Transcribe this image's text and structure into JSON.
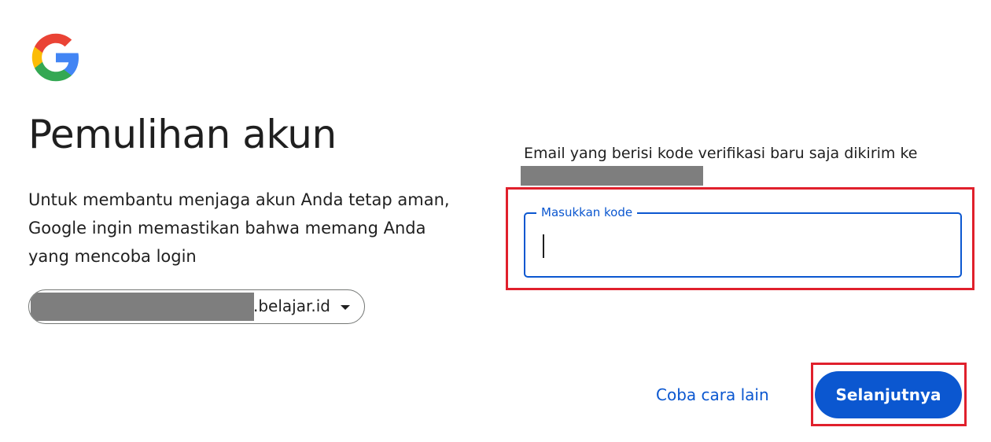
{
  "page": {
    "title": "Pemulihan akun",
    "subtitle": "Untuk membantu menjaga akun Anda tetap aman, Google ingin memastikan bahwa memang Anda yang mencoba login"
  },
  "account": {
    "domain_suffix": ".belajar.id",
    "dropdown_icon": "caret-down-icon"
  },
  "verification": {
    "info_text": "Email yang berisi kode verifikasi baru saja dikirim ke",
    "code_label": "Masukkan kode",
    "code_value": ""
  },
  "actions": {
    "try_another_label": "Coba cara lain",
    "next_label": "Selanjutnya"
  },
  "colors": {
    "accent": "#0b57d0",
    "highlight": "#e0202c",
    "text": "#1f1f1f"
  }
}
